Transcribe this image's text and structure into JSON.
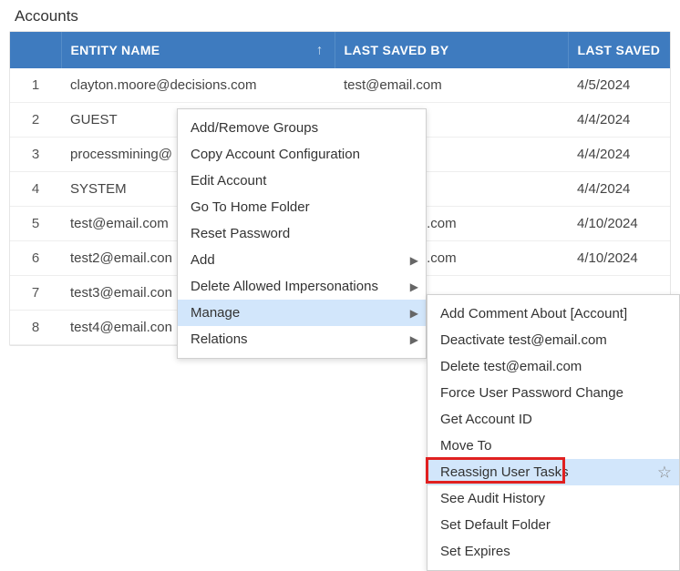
{
  "title": "Accounts",
  "columns": {
    "index": "",
    "entity_name": "ENTITY NAME",
    "last_saved_by": "LAST SAVED BY",
    "last_saved_on": "LAST SAVED"
  },
  "rows": [
    {
      "idx": "1",
      "entity": "clayton.moore@decisions.com",
      "by": "test@email.com",
      "on": "4/5/2024"
    },
    {
      "idx": "2",
      "entity": "GUEST",
      "by": "",
      "on": "4/4/2024"
    },
    {
      "idx": "3",
      "entity": "processmining@",
      "by": "",
      "on": "4/4/2024"
    },
    {
      "idx": "4",
      "entity": "SYSTEM",
      "by": "",
      "on": "4/4/2024"
    },
    {
      "idx": "5",
      "entity": "test@email.com",
      "by": "re@decisions.com",
      "on": "4/10/2024"
    },
    {
      "idx": "6",
      "entity": "test2@email.con",
      "by": "re@decisions.com",
      "on": "4/10/2024"
    },
    {
      "idx": "7",
      "entity": "test3@email.con",
      "by": "",
      "on": ""
    },
    {
      "idx": "8",
      "entity": "test4@email.con",
      "by": "",
      "on": ""
    }
  ],
  "ctx_main": {
    "items": [
      {
        "label": "Add/Remove Groups",
        "sub": false
      },
      {
        "label": "Copy Account Configuration",
        "sub": false
      },
      {
        "label": "Edit Account",
        "sub": false
      },
      {
        "label": "Go To Home Folder",
        "sub": false
      },
      {
        "label": "Reset Password",
        "sub": false
      },
      {
        "label": "Add",
        "sub": true
      },
      {
        "label": "Delete Allowed Impersonations",
        "sub": true
      },
      {
        "label": "Manage",
        "sub": true,
        "hover": true
      },
      {
        "label": "Relations",
        "sub": true
      }
    ]
  },
  "ctx_sub": {
    "items": [
      {
        "label": "Add Comment About [Account]"
      },
      {
        "label": "Deactivate test@email.com"
      },
      {
        "label": "Delete test@email.com"
      },
      {
        "label": "Force User Password Change"
      },
      {
        "label": "Get Account ID"
      },
      {
        "label": "Move To"
      },
      {
        "label": "Reassign User Tasks",
        "hover": true,
        "star": true,
        "highlight": true
      },
      {
        "label": "See Audit History"
      },
      {
        "label": "Set Default Folder"
      },
      {
        "label": "Set Expires"
      }
    ]
  }
}
